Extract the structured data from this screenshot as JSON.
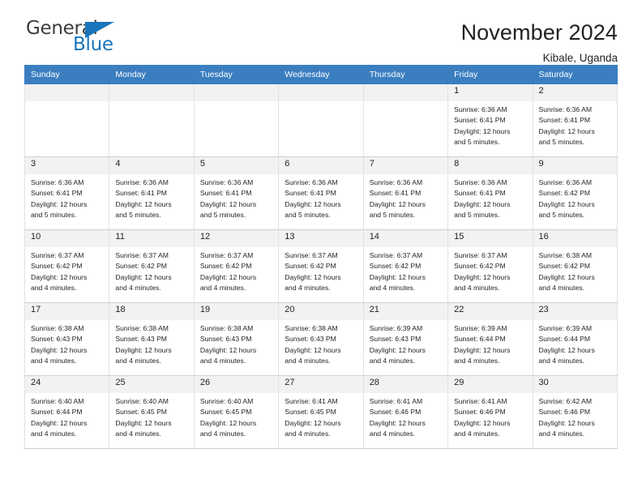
{
  "brand": {
    "name_part1": "General",
    "name_part2": "Blue",
    "accent_color": "#1b75bb"
  },
  "header": {
    "title": "November 2024",
    "subtitle": "Kibale, Uganda"
  },
  "theme": {
    "header_bg": "#3b7ec0",
    "header_text": "#ffffff",
    "daynum_bg": "#f2f2f2",
    "body_text": "#231f20"
  },
  "weekdays": [
    "Sunday",
    "Monday",
    "Tuesday",
    "Wednesday",
    "Thursday",
    "Friday",
    "Saturday"
  ],
  "labels": {
    "sunrise_prefix": "Sunrise:",
    "sunset_prefix": "Sunset:",
    "daylight_prefix": "Daylight:"
  },
  "weeks": [
    [
      {
        "day": "",
        "blank": true,
        "line1": "",
        "line2": "",
        "line3": "",
        "line4": ""
      },
      {
        "day": "",
        "blank": true,
        "line1": "",
        "line2": "",
        "line3": "",
        "line4": ""
      },
      {
        "day": "",
        "blank": true,
        "line1": "",
        "line2": "",
        "line3": "",
        "line4": ""
      },
      {
        "day": "",
        "blank": true,
        "line1": "",
        "line2": "",
        "line3": "",
        "line4": ""
      },
      {
        "day": "",
        "blank": true,
        "line1": "",
        "line2": "",
        "line3": "",
        "line4": ""
      },
      {
        "day": "1",
        "blank": false,
        "line1": "Sunrise: 6:36 AM",
        "line2": "Sunset: 6:41 PM",
        "line3": "Daylight: 12 hours",
        "line4": "and 5 minutes."
      },
      {
        "day": "2",
        "blank": false,
        "line1": "Sunrise: 6:36 AM",
        "line2": "Sunset: 6:41 PM",
        "line3": "Daylight: 12 hours",
        "line4": "and 5 minutes."
      }
    ],
    [
      {
        "day": "3",
        "blank": false,
        "line1": "Sunrise: 6:36 AM",
        "line2": "Sunset: 6:41 PM",
        "line3": "Daylight: 12 hours",
        "line4": "and 5 minutes."
      },
      {
        "day": "4",
        "blank": false,
        "line1": "Sunrise: 6:36 AM",
        "line2": "Sunset: 6:41 PM",
        "line3": "Daylight: 12 hours",
        "line4": "and 5 minutes."
      },
      {
        "day": "5",
        "blank": false,
        "line1": "Sunrise: 6:36 AM",
        "line2": "Sunset: 6:41 PM",
        "line3": "Daylight: 12 hours",
        "line4": "and 5 minutes."
      },
      {
        "day": "6",
        "blank": false,
        "line1": "Sunrise: 6:36 AM",
        "line2": "Sunset: 6:41 PM",
        "line3": "Daylight: 12 hours",
        "line4": "and 5 minutes."
      },
      {
        "day": "7",
        "blank": false,
        "line1": "Sunrise: 6:36 AM",
        "line2": "Sunset: 6:41 PM",
        "line3": "Daylight: 12 hours",
        "line4": "and 5 minutes."
      },
      {
        "day": "8",
        "blank": false,
        "line1": "Sunrise: 6:36 AM",
        "line2": "Sunset: 6:41 PM",
        "line3": "Daylight: 12 hours",
        "line4": "and 5 minutes."
      },
      {
        "day": "9",
        "blank": false,
        "line1": "Sunrise: 6:36 AM",
        "line2": "Sunset: 6:42 PM",
        "line3": "Daylight: 12 hours",
        "line4": "and 5 minutes."
      }
    ],
    [
      {
        "day": "10",
        "blank": false,
        "line1": "Sunrise: 6:37 AM",
        "line2": "Sunset: 6:42 PM",
        "line3": "Daylight: 12 hours",
        "line4": "and 4 minutes."
      },
      {
        "day": "11",
        "blank": false,
        "line1": "Sunrise: 6:37 AM",
        "line2": "Sunset: 6:42 PM",
        "line3": "Daylight: 12 hours",
        "line4": "and 4 minutes."
      },
      {
        "day": "12",
        "blank": false,
        "line1": "Sunrise: 6:37 AM",
        "line2": "Sunset: 6:42 PM",
        "line3": "Daylight: 12 hours",
        "line4": "and 4 minutes."
      },
      {
        "day": "13",
        "blank": false,
        "line1": "Sunrise: 6:37 AM",
        "line2": "Sunset: 6:42 PM",
        "line3": "Daylight: 12 hours",
        "line4": "and 4 minutes."
      },
      {
        "day": "14",
        "blank": false,
        "line1": "Sunrise: 6:37 AM",
        "line2": "Sunset: 6:42 PM",
        "line3": "Daylight: 12 hours",
        "line4": "and 4 minutes."
      },
      {
        "day": "15",
        "blank": false,
        "line1": "Sunrise: 6:37 AM",
        "line2": "Sunset: 6:42 PM",
        "line3": "Daylight: 12 hours",
        "line4": "and 4 minutes."
      },
      {
        "day": "16",
        "blank": false,
        "line1": "Sunrise: 6:38 AM",
        "line2": "Sunset: 6:42 PM",
        "line3": "Daylight: 12 hours",
        "line4": "and 4 minutes."
      }
    ],
    [
      {
        "day": "17",
        "blank": false,
        "line1": "Sunrise: 6:38 AM",
        "line2": "Sunset: 6:43 PM",
        "line3": "Daylight: 12 hours",
        "line4": "and 4 minutes."
      },
      {
        "day": "18",
        "blank": false,
        "line1": "Sunrise: 6:38 AM",
        "line2": "Sunset: 6:43 PM",
        "line3": "Daylight: 12 hours",
        "line4": "and 4 minutes."
      },
      {
        "day": "19",
        "blank": false,
        "line1": "Sunrise: 6:38 AM",
        "line2": "Sunset: 6:43 PM",
        "line3": "Daylight: 12 hours",
        "line4": "and 4 minutes."
      },
      {
        "day": "20",
        "blank": false,
        "line1": "Sunrise: 6:38 AM",
        "line2": "Sunset: 6:43 PM",
        "line3": "Daylight: 12 hours",
        "line4": "and 4 minutes."
      },
      {
        "day": "21",
        "blank": false,
        "line1": "Sunrise: 6:39 AM",
        "line2": "Sunset: 6:43 PM",
        "line3": "Daylight: 12 hours",
        "line4": "and 4 minutes."
      },
      {
        "day": "22",
        "blank": false,
        "line1": "Sunrise: 6:39 AM",
        "line2": "Sunset: 6:44 PM",
        "line3": "Daylight: 12 hours",
        "line4": "and 4 minutes."
      },
      {
        "day": "23",
        "blank": false,
        "line1": "Sunrise: 6:39 AM",
        "line2": "Sunset: 6:44 PM",
        "line3": "Daylight: 12 hours",
        "line4": "and 4 minutes."
      }
    ],
    [
      {
        "day": "24",
        "blank": false,
        "line1": "Sunrise: 6:40 AM",
        "line2": "Sunset: 6:44 PM",
        "line3": "Daylight: 12 hours",
        "line4": "and 4 minutes."
      },
      {
        "day": "25",
        "blank": false,
        "line1": "Sunrise: 6:40 AM",
        "line2": "Sunset: 6:45 PM",
        "line3": "Daylight: 12 hours",
        "line4": "and 4 minutes."
      },
      {
        "day": "26",
        "blank": false,
        "line1": "Sunrise: 6:40 AM",
        "line2": "Sunset: 6:45 PM",
        "line3": "Daylight: 12 hours",
        "line4": "and 4 minutes."
      },
      {
        "day": "27",
        "blank": false,
        "line1": "Sunrise: 6:41 AM",
        "line2": "Sunset: 6:45 PM",
        "line3": "Daylight: 12 hours",
        "line4": "and 4 minutes."
      },
      {
        "day": "28",
        "blank": false,
        "line1": "Sunrise: 6:41 AM",
        "line2": "Sunset: 6:46 PM",
        "line3": "Daylight: 12 hours",
        "line4": "and 4 minutes."
      },
      {
        "day": "29",
        "blank": false,
        "line1": "Sunrise: 6:41 AM",
        "line2": "Sunset: 6:46 PM",
        "line3": "Daylight: 12 hours",
        "line4": "and 4 minutes."
      },
      {
        "day": "30",
        "blank": false,
        "line1": "Sunrise: 6:42 AM",
        "line2": "Sunset: 6:46 PM",
        "line3": "Daylight: 12 hours",
        "line4": "and 4 minutes."
      }
    ]
  ]
}
